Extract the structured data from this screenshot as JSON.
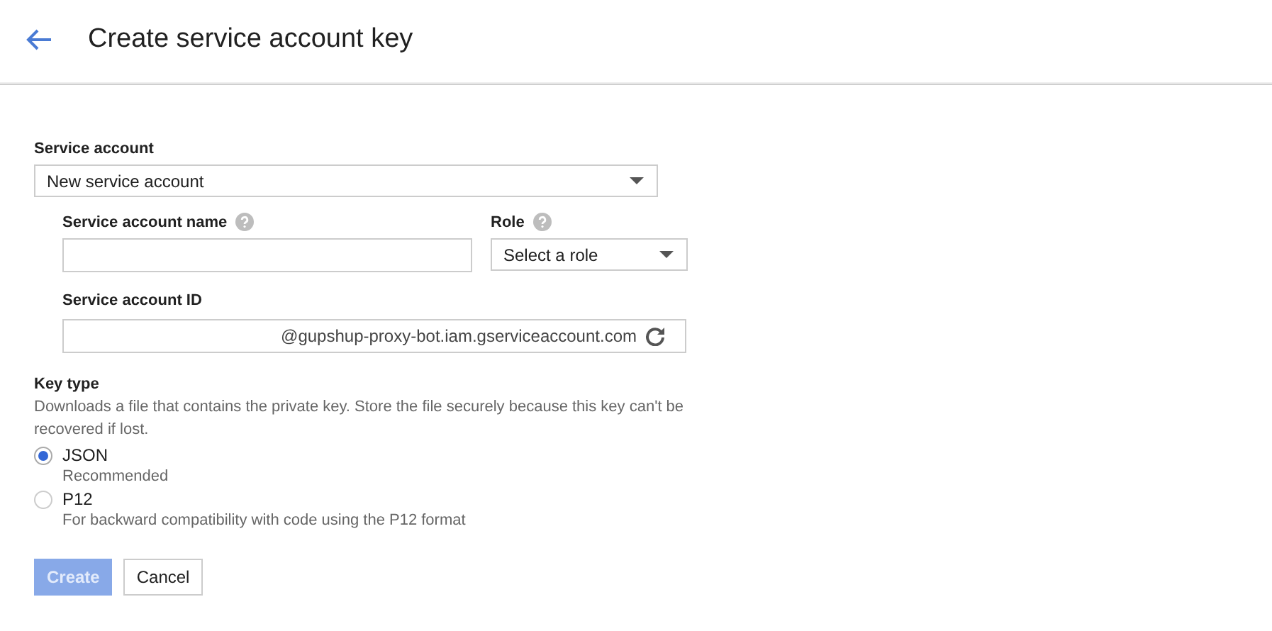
{
  "header": {
    "title": "Create service account key"
  },
  "service_account": {
    "label": "Service account",
    "value": "New service account"
  },
  "new_account": {
    "name_label": "Service account name",
    "role_label": "Role",
    "role_value": "Select a role",
    "id_label": "Service account ID",
    "id_suffix": "@gupshup-proxy-bot.iam.gserviceaccount.com"
  },
  "key_type": {
    "label": "Key type",
    "description": "Downloads a file that contains the private key. Store the file securely because this key can't be recovered if lost.",
    "options": [
      {
        "label": "JSON",
        "hint": "Recommended",
        "selected": true
      },
      {
        "label": "P12",
        "hint": "For backward compatibility with code using the P12 format",
        "selected": false
      }
    ]
  },
  "buttons": [
    {
      "label": "Create",
      "kind": "primary",
      "disabled": true
    },
    {
      "label": "Cancel",
      "kind": "secondary",
      "disabled": false
    }
  ]
}
